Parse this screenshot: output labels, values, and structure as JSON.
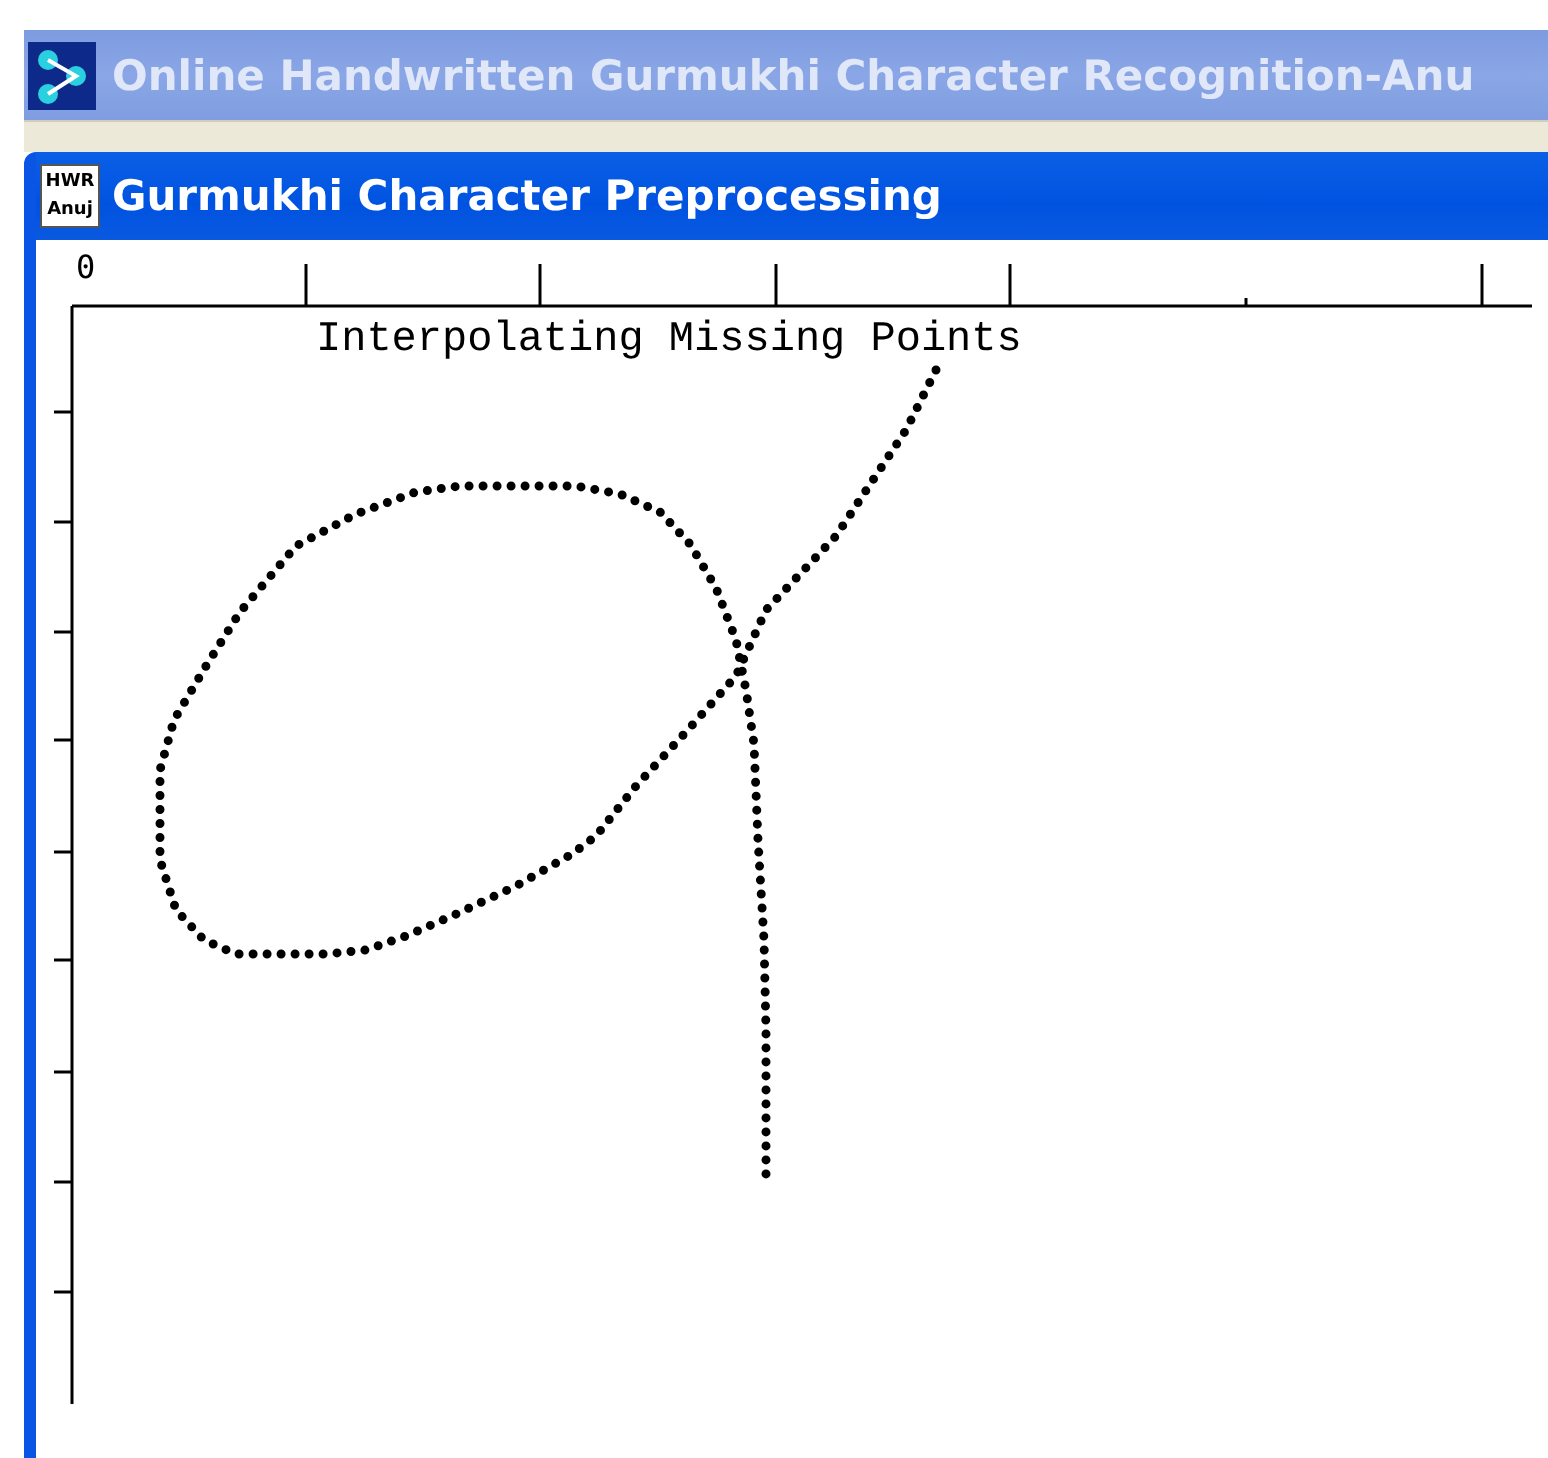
{
  "app_window": {
    "title": "Online Handwritten Gurmukhi Character Recognition-Anu",
    "active": false
  },
  "child_window": {
    "title": "Gurmukhi Character Preprocessing",
    "active": true,
    "icon_text": [
      "HWR",
      "Anuj"
    ]
  },
  "plot": {
    "title": "Interpolating Missing Points",
    "x_tick_label": "0"
  }
}
